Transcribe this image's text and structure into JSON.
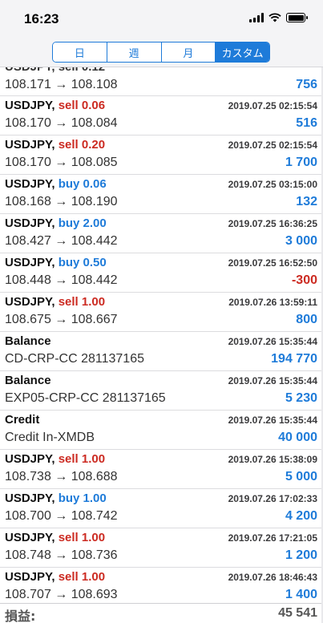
{
  "status": {
    "time": "16:23"
  },
  "segments": [
    {
      "label": "日",
      "active": false
    },
    {
      "label": "週",
      "active": false
    },
    {
      "label": "月",
      "active": false
    },
    {
      "label": "カスタム",
      "active": true
    }
  ],
  "partial_row": {
    "title": "USDJPY, sell 0.12",
    "sub": "108.171 → 108.108",
    "amount": "756"
  },
  "rows": [
    {
      "symbol": "USDJPY,",
      "side": "sell",
      "lot": "0.06",
      "date": "2019.07.25 02:15:54",
      "sub": "108.170 → 108.084",
      "amount": "516",
      "negative": false
    },
    {
      "symbol": "USDJPY,",
      "side": "sell",
      "lot": "0.20",
      "date": "2019.07.25 02:15:54",
      "sub": "108.170 → 108.085",
      "amount": "1 700",
      "negative": false
    },
    {
      "symbol": "USDJPY,",
      "side": "buy",
      "lot": "0.06",
      "date": "2019.07.25 03:15:00",
      "sub": "108.168 → 108.190",
      "amount": "132",
      "negative": false
    },
    {
      "symbol": "USDJPY,",
      "side": "buy",
      "lot": "2.00",
      "date": "2019.07.25 16:36:25",
      "sub": "108.427 → 108.442",
      "amount": "3 000",
      "negative": false
    },
    {
      "symbol": "USDJPY,",
      "side": "buy",
      "lot": "0.50",
      "date": "2019.07.25 16:52:50",
      "sub": "108.448 → 108.442",
      "amount": "-300",
      "negative": true
    },
    {
      "symbol": "USDJPY,",
      "side": "sell",
      "lot": "1.00",
      "date": "2019.07.26 13:59:11",
      "sub": "108.675 → 108.667",
      "amount": "800",
      "negative": false
    },
    {
      "symbol": "Balance",
      "side": "",
      "lot": "",
      "date": "2019.07.26 15:35:44",
      "sub": "CD-CRP-CC 281137165",
      "amount": "194 770",
      "negative": false
    },
    {
      "symbol": "Balance",
      "side": "",
      "lot": "",
      "date": "2019.07.26 15:35:44",
      "sub": "EXP05-CRP-CC 281137165",
      "amount": "5 230",
      "negative": false
    },
    {
      "symbol": "Credit",
      "side": "",
      "lot": "",
      "date": "2019.07.26 15:35:44",
      "sub": "Credit In-XMDB",
      "amount": "40 000",
      "negative": false
    },
    {
      "symbol": "USDJPY,",
      "side": "sell",
      "lot": "1.00",
      "date": "2019.07.26 15:38:09",
      "sub": "108.738 → 108.688",
      "amount": "5 000",
      "negative": false
    },
    {
      "symbol": "USDJPY,",
      "side": "buy",
      "lot": "1.00",
      "date": "2019.07.26 17:02:33",
      "sub": "108.700 → 108.742",
      "amount": "4 200",
      "negative": false
    },
    {
      "symbol": "USDJPY,",
      "side": "sell",
      "lot": "1.00",
      "date": "2019.07.26 17:21:05",
      "sub": "108.748 → 108.736",
      "amount": "1 200",
      "negative": false
    },
    {
      "symbol": "USDJPY,",
      "side": "sell",
      "lot": "1.00",
      "date": "2019.07.26 18:46:43",
      "sub": "108.707 → 108.693",
      "amount": "1 400",
      "negative": false
    }
  ],
  "total": {
    "label": "損益:",
    "value": "45 541"
  },
  "colors": {
    "accent": "#1e7bd9",
    "sell": "#cc2b22",
    "negative": "#cc2b22"
  }
}
